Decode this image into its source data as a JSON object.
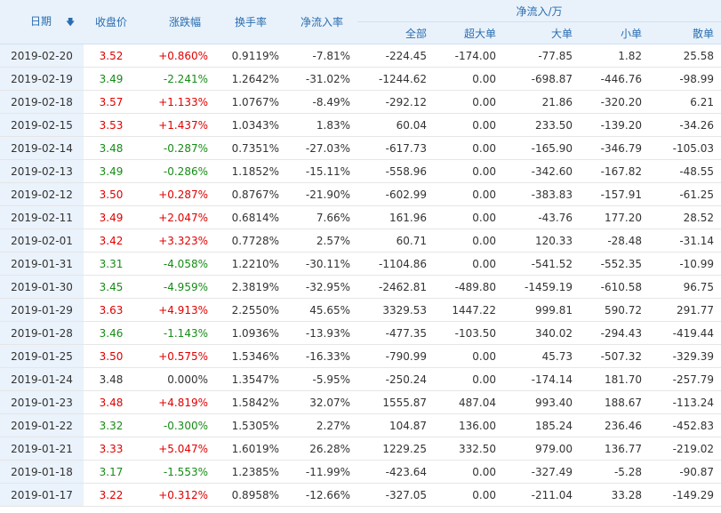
{
  "header": {
    "date": "日期",
    "close": "收盘价",
    "change": "涨跌幅",
    "turnover": "换手率",
    "net_ratio": "净流入率",
    "net_group": "净流入/万",
    "total": "全部",
    "super_large": "超大单",
    "large": "大单",
    "small": "小单",
    "retail": "散单",
    "sort_icon": "sort-down-icon"
  },
  "colors": {
    "up": "#e00000",
    "down": "#168c16",
    "header_text": "#2a6db0",
    "header_bg": "#e9f2fb",
    "date_bg": "#eaf2fb"
  },
  "rows": [
    {
      "date": "2019-02-20",
      "close": "3.52",
      "change": "+0.860%",
      "turnover": "0.9119%",
      "net_ratio": "-7.81%",
      "total": "-224.45",
      "super_large": "-174.00",
      "large": "-77.85",
      "small": "1.82",
      "retail": "25.58",
      "dir": "up"
    },
    {
      "date": "2019-02-19",
      "close": "3.49",
      "change": "-2.241%",
      "turnover": "1.2642%",
      "net_ratio": "-31.02%",
      "total": "-1244.62",
      "super_large": "0.00",
      "large": "-698.87",
      "small": "-446.76",
      "retail": "-98.99",
      "dir": "down"
    },
    {
      "date": "2019-02-18",
      "close": "3.57",
      "change": "+1.133%",
      "turnover": "1.0767%",
      "net_ratio": "-8.49%",
      "total": "-292.12",
      "super_large": "0.00",
      "large": "21.86",
      "small": "-320.20",
      "retail": "6.21",
      "dir": "up"
    },
    {
      "date": "2019-02-15",
      "close": "3.53",
      "change": "+1.437%",
      "turnover": "1.0343%",
      "net_ratio": "1.83%",
      "total": "60.04",
      "super_large": "0.00",
      "large": "233.50",
      "small": "-139.20",
      "retail": "-34.26",
      "dir": "up"
    },
    {
      "date": "2019-02-14",
      "close": "3.48",
      "change": "-0.287%",
      "turnover": "0.7351%",
      "net_ratio": "-27.03%",
      "total": "-617.73",
      "super_large": "0.00",
      "large": "-165.90",
      "small": "-346.79",
      "retail": "-105.03",
      "dir": "down"
    },
    {
      "date": "2019-02-13",
      "close": "3.49",
      "change": "-0.286%",
      "turnover": "1.1852%",
      "net_ratio": "-15.11%",
      "total": "-558.96",
      "super_large": "0.00",
      "large": "-342.60",
      "small": "-167.82",
      "retail": "-48.55",
      "dir": "down"
    },
    {
      "date": "2019-02-12",
      "close": "3.50",
      "change": "+0.287%",
      "turnover": "0.8767%",
      "net_ratio": "-21.90%",
      "total": "-602.99",
      "super_large": "0.00",
      "large": "-383.83",
      "small": "-157.91",
      "retail": "-61.25",
      "dir": "up"
    },
    {
      "date": "2019-02-11",
      "close": "3.49",
      "change": "+2.047%",
      "turnover": "0.6814%",
      "net_ratio": "7.66%",
      "total": "161.96",
      "super_large": "0.00",
      "large": "-43.76",
      "small": "177.20",
      "retail": "28.52",
      "dir": "up"
    },
    {
      "date": "2019-02-01",
      "close": "3.42",
      "change": "+3.323%",
      "turnover": "0.7728%",
      "net_ratio": "2.57%",
      "total": "60.71",
      "super_large": "0.00",
      "large": "120.33",
      "small": "-28.48",
      "retail": "-31.14",
      "dir": "up"
    },
    {
      "date": "2019-01-31",
      "close": "3.31",
      "change": "-4.058%",
      "turnover": "1.2210%",
      "net_ratio": "-30.11%",
      "total": "-1104.86",
      "super_large": "0.00",
      "large": "-541.52",
      "small": "-552.35",
      "retail": "-10.99",
      "dir": "down"
    },
    {
      "date": "2019-01-30",
      "close": "3.45",
      "change": "-4.959%",
      "turnover": "2.3819%",
      "net_ratio": "-32.95%",
      "total": "-2462.81",
      "super_large": "-489.80",
      "large": "-1459.19",
      "small": "-610.58",
      "retail": "96.75",
      "dir": "down"
    },
    {
      "date": "2019-01-29",
      "close": "3.63",
      "change": "+4.913%",
      "turnover": "2.2550%",
      "net_ratio": "45.65%",
      "total": "3329.53",
      "super_large": "1447.22",
      "large": "999.81",
      "small": "590.72",
      "retail": "291.77",
      "dir": "up"
    },
    {
      "date": "2019-01-28",
      "close": "3.46",
      "change": "-1.143%",
      "turnover": "1.0936%",
      "net_ratio": "-13.93%",
      "total": "-477.35",
      "super_large": "-103.50",
      "large": "340.02",
      "small": "-294.43",
      "retail": "-419.44",
      "dir": "down"
    },
    {
      "date": "2019-01-25",
      "close": "3.50",
      "change": "+0.575%",
      "turnover": "1.5346%",
      "net_ratio": "-16.33%",
      "total": "-790.99",
      "super_large": "0.00",
      "large": "45.73",
      "small": "-507.32",
      "retail": "-329.39",
      "dir": "up"
    },
    {
      "date": "2019-01-24",
      "close": "3.48",
      "change": "0.000%",
      "turnover": "1.3547%",
      "net_ratio": "-5.95%",
      "total": "-250.24",
      "super_large": "0.00",
      "large": "-174.14",
      "small": "181.70",
      "retail": "-257.79",
      "dir": "flat"
    },
    {
      "date": "2019-01-23",
      "close": "3.48",
      "change": "+4.819%",
      "turnover": "1.5842%",
      "net_ratio": "32.07%",
      "total": "1555.87",
      "super_large": "487.04",
      "large": "993.40",
      "small": "188.67",
      "retail": "-113.24",
      "dir": "up"
    },
    {
      "date": "2019-01-22",
      "close": "3.32",
      "change": "-0.300%",
      "turnover": "1.5305%",
      "net_ratio": "2.27%",
      "total": "104.87",
      "super_large": "136.00",
      "large": "185.24",
      "small": "236.46",
      "retail": "-452.83",
      "dir": "down"
    },
    {
      "date": "2019-01-21",
      "close": "3.33",
      "change": "+5.047%",
      "turnover": "1.6019%",
      "net_ratio": "26.28%",
      "total": "1229.25",
      "super_large": "332.50",
      "large": "979.00",
      "small": "136.77",
      "retail": "-219.02",
      "dir": "up"
    },
    {
      "date": "2019-01-18",
      "close": "3.17",
      "change": "-1.553%",
      "turnover": "1.2385%",
      "net_ratio": "-11.99%",
      "total": "-423.64",
      "super_large": "0.00",
      "large": "-327.49",
      "small": "-5.28",
      "retail": "-90.87",
      "dir": "down"
    },
    {
      "date": "2019-01-17",
      "close": "3.22",
      "change": "+0.312%",
      "turnover": "0.8958%",
      "net_ratio": "-12.66%",
      "total": "-327.05",
      "super_large": "0.00",
      "large": "-211.04",
      "small": "33.28",
      "retail": "-149.29",
      "dir": "up"
    }
  ]
}
